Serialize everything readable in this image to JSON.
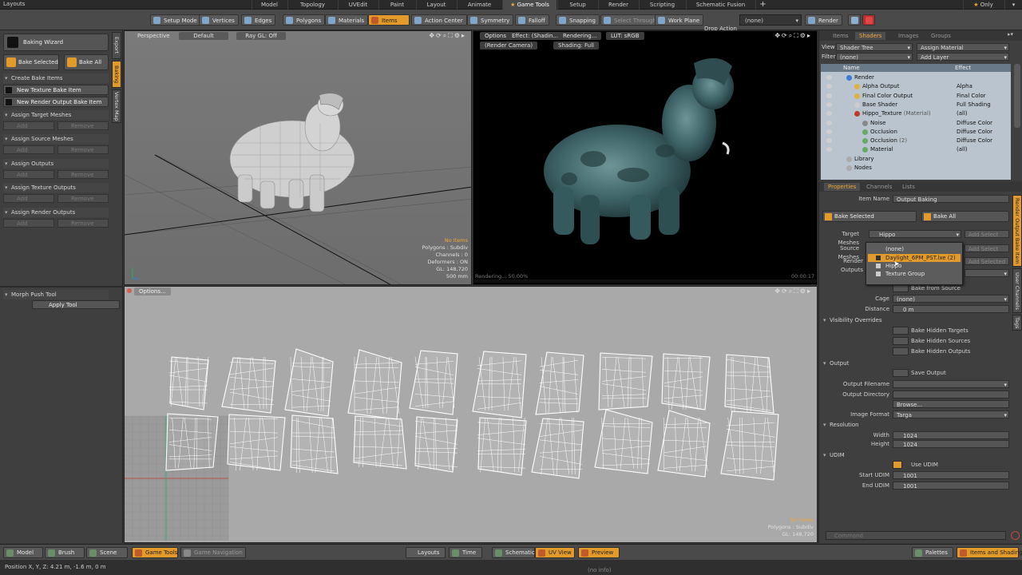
{
  "menubar": {
    "app": "Layouts",
    "tabs": [
      "Model",
      "Topology",
      "UVEdit",
      "Paint",
      "Layout",
      "Animate",
      "Game Tools",
      "Setup",
      "Render",
      "Scripting",
      "Schematic Fusion"
    ],
    "active_tab": "Game Tools",
    "plus": "+",
    "only": "Only"
  },
  "toolbar": {
    "setup_mode": "Setup Mode",
    "vertices": "Vertices",
    "edges": "Edges",
    "polygons": "Polygons",
    "materials": "Materials",
    "items": "Items",
    "action_center": "Action Center",
    "symmetry": "Symmetry",
    "falloff": "Falloff",
    "snapping": "Snapping",
    "select_through": "Select Through",
    "work_plane": "Work Plane",
    "drop_action_label": "Drop Action",
    "drop_action_value": "(none)",
    "render": "Render"
  },
  "left": {
    "baking_wizard": "Baking Wizard",
    "bake_selected": "Bake Selected",
    "bake_all": "Bake All",
    "create_bake_items": "Create Bake Items",
    "new_texture_bake": "New Texture Bake Item",
    "new_render_output_bake": "New Render Output Bake Item",
    "sections": [
      "Assign Target Meshes",
      "Assign Source Meshes",
      "Assign Outputs",
      "Assign Texture Outputs",
      "Assign Render Outputs"
    ],
    "add": "Add",
    "remove": "Remove",
    "morph_push_tool": "Morph Push Tool",
    "apply_tool": "Apply Tool",
    "vtabs": [
      "Export",
      "Baking",
      "Vertex Map"
    ]
  },
  "viewport_persp": {
    "view": "Perspective",
    "shading": "Default",
    "raygl": "Ray GL: Off",
    "info_hl": "No Items",
    "info": [
      "Polygons : Subdiv",
      "Channels : 0",
      "Deformers : ON",
      "GL: 148,720",
      "500 mm"
    ]
  },
  "viewport_render": {
    "options": "Options",
    "effect": "Effect: (Shadin...",
    "rendering_btn": "Rendering...",
    "lut": "LUT: sRGB",
    "camera": "(Render Camera)",
    "shading": "Shading: Full",
    "progress": "Rendering... 50.00%",
    "time": "00:00:17"
  },
  "viewport_uv": {
    "options": "Options...",
    "info_hl": "No Items",
    "info": [
      "Polygons : Subdiv",
      "GL: 148,720"
    ]
  },
  "shader": {
    "tabs": [
      "Items",
      "Shaders",
      "Images",
      "Groups"
    ],
    "active_tab": "Shaders",
    "view_label": "View",
    "view_value": "Shader Tree",
    "assign_material": "Assign Material",
    "filter_label": "Filter",
    "filter_value": "(none)",
    "add_layer": "Add Layer",
    "col_name": "Name",
    "col_effect": "Effect",
    "rows": [
      {
        "name": "Render",
        "extra": "",
        "effect": "",
        "indent": 0
      },
      {
        "name": "Alpha Output",
        "extra": "",
        "effect": "Alpha",
        "indent": 1
      },
      {
        "name": "Final Color Output",
        "extra": "",
        "effect": "Final Color",
        "indent": 1
      },
      {
        "name": "Base Shader",
        "extra": "",
        "effect": "Full Shading",
        "indent": 1
      },
      {
        "name": "Hippo_Texture",
        "extra": "(Material)",
        "effect": "(all)",
        "indent": 1
      },
      {
        "name": "Noise",
        "extra": "",
        "effect": "Diffuse Color",
        "indent": 2
      },
      {
        "name": "Occlusion",
        "extra": "",
        "effect": "Diffuse Color",
        "indent": 2
      },
      {
        "name": "Occlusion",
        "extra": "(2)",
        "effect": "Diffuse Color",
        "indent": 2
      },
      {
        "name": "Material",
        "extra": "",
        "effect": "(all)",
        "indent": 2
      },
      {
        "name": "Library",
        "extra": "",
        "effect": "",
        "indent": 0
      },
      {
        "name": "Nodes",
        "extra": "",
        "effect": "",
        "indent": 0
      }
    ]
  },
  "props": {
    "tabs": [
      "Properties",
      "Channels",
      "Lists"
    ],
    "active_tab": "Properties",
    "item_name_label": "Item Name",
    "item_name_value": "Output Baking",
    "bake_selected": "Bake Selected",
    "bake_all": "Bake All",
    "target_meshes_label": "Target Meshes",
    "target_meshes_value": "Hippo",
    "source_meshes_label": "Source Meshes",
    "render_outputs_label": "Render Outputs",
    "add_select": "Add Select",
    "add_selected": "Add Selected",
    "bake_from_source": "Bake from Source",
    "cage_label": "Cage",
    "cage_value": "(none)",
    "distance_label": "Distance",
    "distance_value": "0 m",
    "visibility_overrides": "Visibility Overrides",
    "bake_hidden_targets": "Bake Hidden Targets",
    "bake_hidden_sources": "Bake Hidden Sources",
    "bake_hidden_outputs": "Bake Hidden Outputs",
    "output": "Output",
    "save_output": "Save Output",
    "output_filename_label": "Output Filename",
    "output_directory_label": "Output Directory",
    "browse": "Browse...",
    "image_format_label": "Image Format",
    "image_format_value": "Targa",
    "resolution": "Resolution",
    "width_label": "Width",
    "width_value": "1024",
    "height_label": "Height",
    "height_value": "1024",
    "udim": "UDIM",
    "use_udim": "Use UDIM",
    "start_udim_label": "Start UDIM",
    "start_udim_value": "1001",
    "end_udim_label": "End UDIM",
    "end_udim_value": "1001",
    "command_placeholder": "Command",
    "vtabs": [
      "Render Output Bake Item",
      "User Channels",
      "Tags"
    ]
  },
  "dropdown": {
    "items": [
      "(none)",
      "Daylight_6PM_PST.lxe (2)",
      "Hippo",
      "Texture Group"
    ],
    "highlighted": 1
  },
  "bottombar": {
    "model": "Model",
    "brush": "Brush",
    "scene": "Scene",
    "game_tools": "Game Tools",
    "game_navigation": "Game Navigation",
    "layouts": "Layouts",
    "time": "Time",
    "schematic": "Schematic",
    "uv_view": "UV View",
    "preview": "Preview",
    "palettes": "Palettes",
    "items_and_shading": "Items and Shading"
  },
  "status": {
    "position": "Position X, Y, Z:   4.21 m, -1.6 m, 0 m",
    "info": "(no info)"
  },
  "colors": {
    "accent": "#e29a2b",
    "highlight_text": "#f0a637",
    "uv_grid_x": "#c0392b",
    "uv_grid_y": "#27ae60"
  }
}
